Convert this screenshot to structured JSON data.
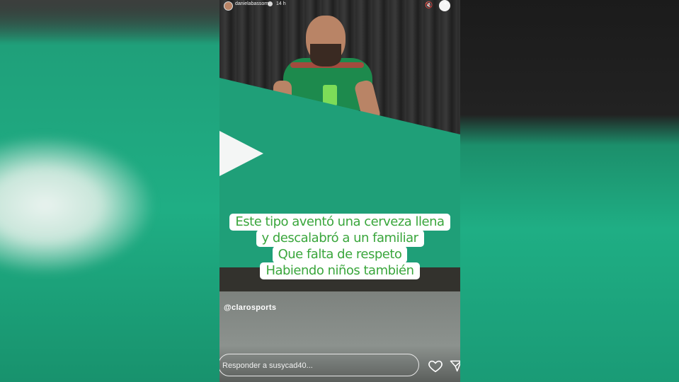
{
  "story": {
    "username": "danielabassom",
    "time": "14 h",
    "caption_lines": [
      "Este tipo aventó una cerveza llena",
      "y descalabró a un familiar",
      "Que falta de respeto",
      "Habiendo niños también"
    ],
    "mention": "@clarosports",
    "reply_placeholder": "Responder a susycad40...",
    "icons": {
      "mute": "speaker-mute-icon",
      "menu": "more-options-icon",
      "like": "heart-icon",
      "share": "send-icon"
    },
    "colors": {
      "caption_text": "#3aa63c",
      "caption_bg": "#ffffff",
      "wall": "#1f9f78"
    }
  }
}
